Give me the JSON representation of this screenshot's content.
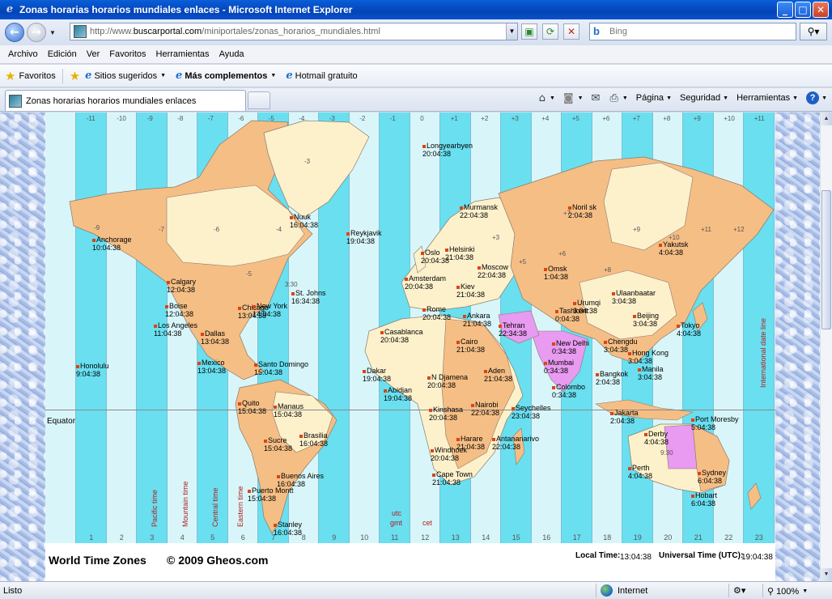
{
  "window": {
    "title": "Zonas horarias horarios mundiales enlaces - Microsoft Internet Explorer",
    "minimize": "_",
    "maximize": "□",
    "close": "✕"
  },
  "address": {
    "url_prefix": "http://www.",
    "url_domain": "buscarportal.com",
    "url_path": "/miniportales/zonas_horarios_mundiales.html",
    "search_placeholder": "Bing"
  },
  "menu": [
    "Archivo",
    "Edición",
    "Ver",
    "Favoritos",
    "Herramientas",
    "Ayuda"
  ],
  "favorites_bar": {
    "favorites": "Favoritos",
    "suggested": "Sitios sugeridos",
    "addons": "Más complementos",
    "hotmail": "Hotmail gratuito"
  },
  "tab": {
    "title": "Zonas horarias horarios mundiales enlaces"
  },
  "command_bar": {
    "page": "Página",
    "security": "Seguridad",
    "tools": "Herramientas"
  },
  "map": {
    "top_offsets": [
      "-11",
      "-10",
      "-9",
      "-8",
      "-7",
      "-6",
      "-5",
      "-4",
      "-3",
      "-2",
      "-1",
      "0",
      "+1",
      "+2",
      "+3",
      "+4",
      "+5",
      "+6",
      "+7",
      "+8",
      "+9",
      "+10",
      "+11"
    ],
    "bottom_numbers": [
      "1",
      "2",
      "3",
      "4",
      "5",
      "6",
      "7",
      "8",
      "9",
      "10",
      "11",
      "12",
      "13",
      "14",
      "15",
      "16",
      "17",
      "18",
      "19",
      "20",
      "21",
      "22",
      "23"
    ],
    "equator": "Equator",
    "date_line": "International date line",
    "pacific": "Pacific time",
    "mountain": "Mountain time",
    "central": "Central time",
    "eastern": "Eastern time",
    "utc": "utc",
    "gmt": "gmt",
    "cet": "cet",
    "cities": [
      {
        "name": "Longyearbyen",
        "time": "20:04:38"
      },
      {
        "name": "Murmansk",
        "time": "22:04:38"
      },
      {
        "name": "Noril sk",
        "time": "2:04:38"
      },
      {
        "name": "Nuuk",
        "time": "16:04:38"
      },
      {
        "name": "Reykjavik",
        "time": "19:04:38"
      },
      {
        "name": "Anchorage",
        "time": "10:04:38"
      },
      {
        "name": "Oslo",
        "time": "20:04:38"
      },
      {
        "name": "Helsinki",
        "time": "21:04:38"
      },
      {
        "name": "Moscow",
        "time": "22:04:38"
      },
      {
        "name": "Omsk",
        "time": "1:04:38"
      },
      {
        "name": "Yakutsk",
        "time": "4:04:38"
      },
      {
        "name": "Calgary",
        "time": "12:04:38"
      },
      {
        "name": "St. Johns",
        "time": "16:34:38"
      },
      {
        "name": "Amsterdam",
        "time": "20:04:38"
      },
      {
        "name": "Kiev",
        "time": "21:04:38"
      },
      {
        "name": "Urumqi",
        "time": "3:04:38"
      },
      {
        "name": "Ulaanbaatar",
        "time": "3:04:38"
      },
      {
        "name": "Boise",
        "time": "12:04:38"
      },
      {
        "name": "Chicago",
        "time": "13:04:38"
      },
      {
        "name": "New York",
        "time": "14:04:38"
      },
      {
        "name": "Rome",
        "time": "20:04:38"
      },
      {
        "name": "Ankara",
        "time": "21:04:38"
      },
      {
        "name": "Tashkent",
        "time": "0:04:38"
      },
      {
        "name": "Beijing",
        "time": "3:04:38"
      },
      {
        "name": "Los Angeles",
        "time": "11:04:38"
      },
      {
        "name": "Dallas",
        "time": "13:04:38"
      },
      {
        "name": "Casablanca",
        "time": "20:04:38"
      },
      {
        "name": "Tehran",
        "time": "22:34:38"
      },
      {
        "name": "Tokyo",
        "time": "4:04:38"
      },
      {
        "name": "Cairo",
        "time": "21:04:38"
      },
      {
        "name": "New Delhi",
        "time": "0:34:38"
      },
      {
        "name": "Chengdu",
        "time": "3:04:38"
      },
      {
        "name": "Hong Kong",
        "time": "3:04:38"
      },
      {
        "name": "Honolulu",
        "time": "9:04:38"
      },
      {
        "name": "Mexico",
        "time": "13:04:38"
      },
      {
        "name": "Santo Domingo",
        "time": "15:04:38"
      },
      {
        "name": "Dakar",
        "time": "19:04:38"
      },
      {
        "name": "N Djamena",
        "time": "20:04:38"
      },
      {
        "name": "Aden",
        "time": "21:04:38"
      },
      {
        "name": "Mumbai",
        "time": "0:34:38"
      },
      {
        "name": "Bangkok",
        "time": "2:04:38"
      },
      {
        "name": "Manila",
        "time": "3:04:38"
      },
      {
        "name": "Abidjan",
        "time": "19:04:38"
      },
      {
        "name": "Colombo",
        "time": "0:34:38"
      },
      {
        "name": "Quito",
        "time": "15:04:38"
      },
      {
        "name": "Manaus",
        "time": "15:04:38"
      },
      {
        "name": "Nairobi",
        "time": "22:04:38"
      },
      {
        "name": "Kinshasa",
        "time": "20:04:38"
      },
      {
        "name": "Seychelles",
        "time": "23:04:38"
      },
      {
        "name": "Jakarta",
        "time": "2:04:38"
      },
      {
        "name": "Port Moresby",
        "time": "5:04:38"
      },
      {
        "name": "Brasilia",
        "time": "16:04:38"
      },
      {
        "name": "Harare",
        "time": "21:04:38"
      },
      {
        "name": "Antananarivo",
        "time": "22:04:38"
      },
      {
        "name": "Sucre",
        "time": "15:04:38"
      },
      {
        "name": "Derby",
        "time": "4:04:38"
      },
      {
        "name": "Windhoek",
        "time": "20:04:38"
      },
      {
        "name": "Cape Town",
        "time": "21:04:38"
      },
      {
        "name": "Perth",
        "time": "4:04:38"
      },
      {
        "name": "Sydney",
        "time": "6:04:38"
      },
      {
        "name": "Buenos Aires",
        "time": "16:04:38"
      },
      {
        "name": "Puerto Montt",
        "time": "15:04:38"
      },
      {
        "name": "Hobart",
        "time": "6:04:38"
      },
      {
        "name": "Stanley",
        "time": "16:04:38"
      }
    ],
    "region_offsets": [
      "-9",
      "-7",
      "-3",
      "-5",
      "-6",
      "-4",
      "+3",
      "+5",
      "+6",
      "+8",
      "+9",
      "+10",
      "+11",
      "+12",
      "+7",
      "3:30",
      "9:30"
    ]
  },
  "footer": {
    "title": "World Time Zones",
    "copyright": "© 2009 Gheos.com",
    "local_label": "Local Time:",
    "local_value": "13:04:38",
    "utc_label": "Universal Time (UTC):",
    "utc_value": "19:04:38"
  },
  "status": {
    "text": "Listo",
    "zone": "Internet",
    "zoom": "100%"
  },
  "colors": {
    "band_a": "#d8f6fa",
    "band_b": "#69dff0",
    "land_orange": "#f5be85",
    "land_cream": "#fdf1cc",
    "land_pink": "#e89bf0"
  }
}
